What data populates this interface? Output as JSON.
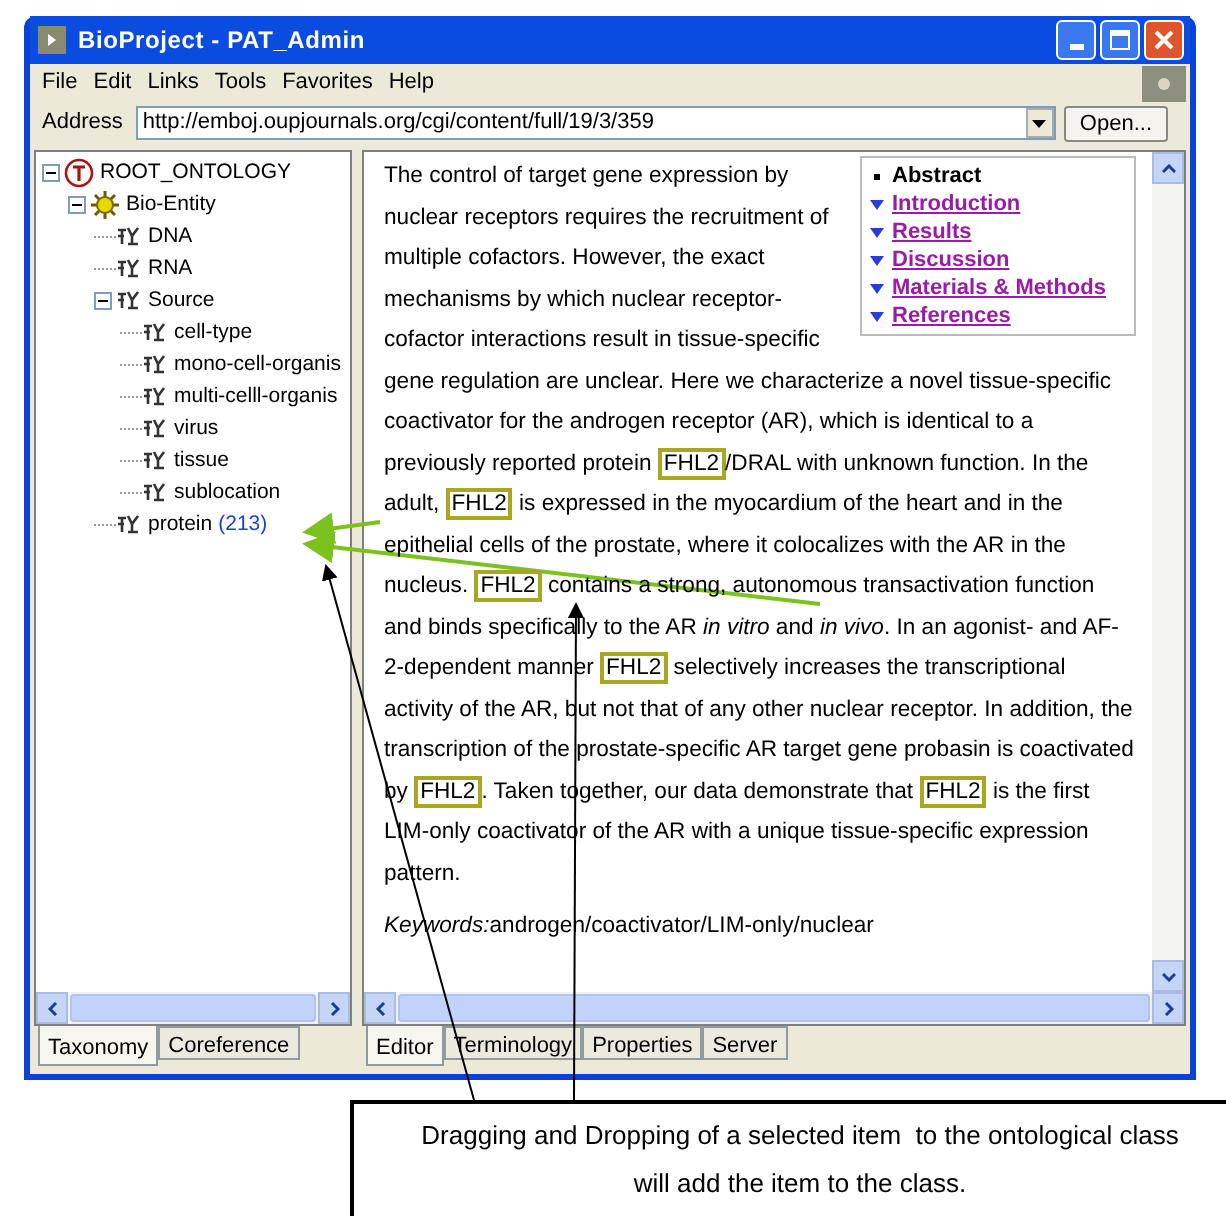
{
  "window": {
    "title": "BioProject - PAT_Admin"
  },
  "menu": [
    {
      "label": "File"
    },
    {
      "label": "Edit"
    },
    {
      "label": "Links"
    },
    {
      "label": "Tools"
    },
    {
      "label": "Favorites"
    },
    {
      "label": "Help"
    }
  ],
  "address": {
    "label": "Address",
    "value": "http://emboj.oupjournals.org/cgi/content/full/19/3/359",
    "button": "Open..."
  },
  "tree": {
    "label": "ROOT_ONTOLOGY",
    "kind": "root",
    "expanded": true,
    "children": [
      {
        "label": "Bio-Entity",
        "kind": "entity",
        "expanded": true,
        "children": [
          {
            "label": "DNA",
            "kind": "class"
          },
          {
            "label": "RNA",
            "kind": "class"
          },
          {
            "label": "Source",
            "kind": "class",
            "expanded": true,
            "children": [
              {
                "label": "cell-type",
                "kind": "class"
              },
              {
                "label": "mono-cell-organis",
                "kind": "class"
              },
              {
                "label": "multi-celll-organis",
                "kind": "class"
              },
              {
                "label": "virus",
                "kind": "class"
              },
              {
                "label": "tissue",
                "kind": "class"
              },
              {
                "label": "sublocation",
                "kind": "class"
              }
            ]
          },
          {
            "label": "protein",
            "kind": "class",
            "count": "(213)"
          }
        ]
      }
    ]
  },
  "left_tabs": [
    {
      "label": "Taxonomy",
      "selected": true
    },
    {
      "label": "Coreference",
      "selected": false
    }
  ],
  "toc": [
    {
      "label": "Abstract",
      "kind": "bullet"
    },
    {
      "label": "Introduction",
      "kind": "link"
    },
    {
      "label": "Results",
      "kind": "link"
    },
    {
      "label": "Discussion",
      "kind": "link"
    },
    {
      "label": "Materials & Methods",
      "kind": "link"
    },
    {
      "label": "References",
      "kind": "link"
    }
  ],
  "paragraph": [
    {
      "kind": "text",
      "text": "The control of target gene expression by nuclear receptors requires the recruitment of multiple cofactors. However, the exact mechanisms by which nuclear receptor-cofactor interactions result in tissue-specific gene regulation are unclear. Here we characterize a novel tissue-specific coactivator for the androgen receptor (AR), which is identical to a previously reported protein "
    },
    {
      "kind": "term",
      "text": "FHL2"
    },
    {
      "kind": "text",
      "text": "/DRAL with unknown function. In the adult, "
    },
    {
      "kind": "term",
      "text": "FHL2"
    },
    {
      "kind": "text",
      "text": " is expressed in the myocardium of the heart and in the epithelial cells of the prostate, where it colocalizes with the AR in the nucleus. "
    },
    {
      "kind": "term",
      "text": "FHL2"
    },
    {
      "kind": "text",
      "text": " contains a strong, autonomous transactivation function and binds specifically to the AR "
    },
    {
      "kind": "italic",
      "text": "in vitro"
    },
    {
      "kind": "text",
      "text": " and "
    },
    {
      "kind": "italic",
      "text": "in vivo"
    },
    {
      "kind": "text",
      "text": ". In an agonist- and AF-2-dependent manner "
    },
    {
      "kind": "term",
      "text": "FHL2"
    },
    {
      "kind": "text",
      "text": " selectively increases the transcriptional activity of the AR, but not that of any other nuclear receptor. In addition, the transcription of the prostate-specific AR target gene probasin is coactivated by "
    },
    {
      "kind": "term",
      "text": "FHL2"
    },
    {
      "kind": "text",
      "text": ". Taken together, our data demonstrate that "
    },
    {
      "kind": "term",
      "text": "FHL2"
    },
    {
      "kind": "text",
      "text": " is the first LIM-only coactivator of the AR with a unique tissue-specific expression pattern."
    }
  ],
  "keywords": {
    "label": "Keywords:",
    "value": "androgen/coactivator/LIM-only/nuclear"
  },
  "right_tabs": [
    {
      "label": "Editor",
      "selected": true
    },
    {
      "label": "Terminology",
      "selected": false
    },
    {
      "label": "Properties",
      "selected": false
    },
    {
      "label": "Server",
      "selected": false
    }
  ],
  "callout": {
    "lines": [
      "Dragging and Dropping of a selected item  to the ontological class",
      "will add the item to the class."
    ]
  }
}
